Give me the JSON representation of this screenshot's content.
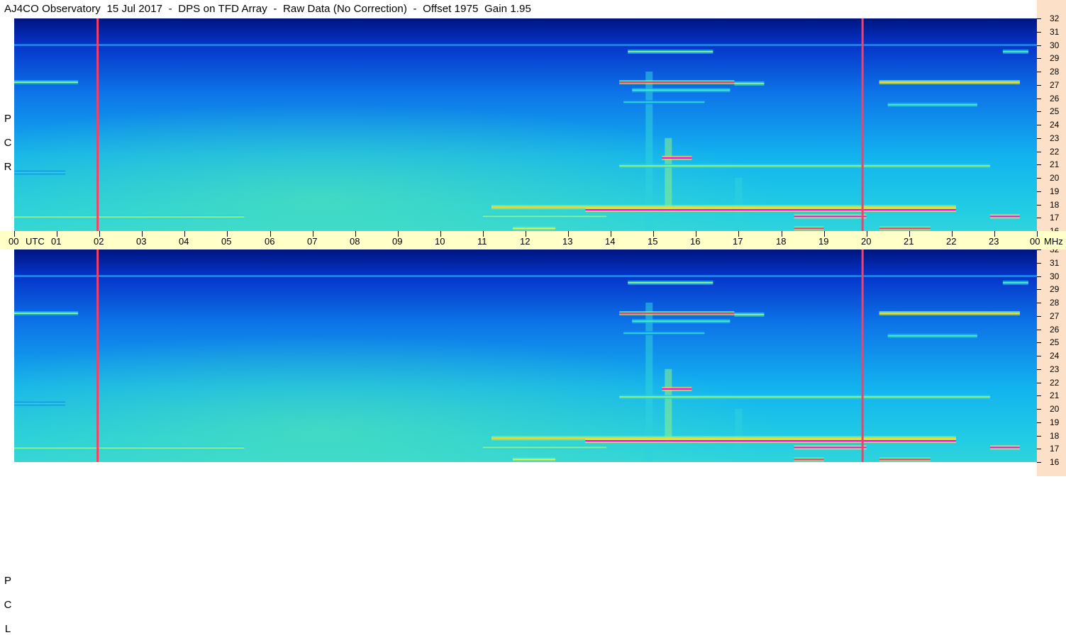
{
  "header": {
    "title": "AJ4CO Observatory  15 Jul 2017  -  DPS on TFD Array  -  Raw Data (No Correction)  -  Offset 1975  Gain 1.95"
  },
  "panels": [
    {
      "id": "rcp",
      "label_letters": [
        "P",
        "C",
        "R"
      ]
    },
    {
      "id": "lcp",
      "label_letters": [
        "P",
        "C",
        "L"
      ]
    }
  ],
  "axes": {
    "frequency_ticks": [
      "32",
      "31",
      "30",
      "29",
      "28",
      "27",
      "26",
      "25",
      "24",
      "23",
      "22",
      "21",
      "20",
      "19",
      "18",
      "17",
      "16"
    ],
    "time_ticks": [
      "00",
      "01",
      "02",
      "03",
      "04",
      "05",
      "06",
      "07",
      "08",
      "09",
      "10",
      "11",
      "12",
      "13",
      "14",
      "15",
      "16",
      "17",
      "18",
      "19",
      "20",
      "21",
      "22",
      "23",
      "00"
    ],
    "time_unit": "UTC",
    "freq_unit": "MHz"
  },
  "colors": {
    "colormap": [
      "#000a8c",
      "#0530c8",
      "#0a5ae6",
      "#0f8cf0",
      "#14bef0",
      "#2ed2dc",
      "#50e6be",
      "#8cf08c",
      "#dcf050",
      "#ffd228",
      "#ff3c64",
      "#ff00ff",
      "#ffffff"
    ],
    "time_axis_bg": "#ffffc8",
    "freq_axis_bg": "#fde0c8",
    "marker_line": "#ff3c64"
  },
  "chart_data": {
    "type": "heatmap",
    "title": "AJ4CO Observatory  15 Jul 2017  -  DPS on TFD Array  -  Raw Data (No Correction)  -  Offset 1975  Gain 1.95",
    "xlabel": "UTC",
    "ylabel": "MHz",
    "xlim": [
      0,
      24
    ],
    "ylim": [
      16,
      32
    ],
    "panels": [
      "RCP",
      "LCP"
    ],
    "marker_lines_utc": [
      1.95,
      19.9
    ],
    "horizontal_line_mhz": [
      30.0
    ],
    "bands": [
      {
        "mhz": 27.2,
        "start_utc": 14.2,
        "end_utc": 16.9,
        "level": 0.82
      },
      {
        "mhz": 27.2,
        "start_utc": 20.3,
        "end_utc": 23.6,
        "level": 0.75
      },
      {
        "mhz": 27.2,
        "start_utc": 0.0,
        "end_utc": 1.5,
        "level": 0.55
      },
      {
        "mhz": 27.1,
        "start_utc": 16.9,
        "end_utc": 17.6,
        "level": 0.6
      },
      {
        "mhz": 29.5,
        "start_utc": 14.4,
        "end_utc": 16.4,
        "level": 0.55
      },
      {
        "mhz": 29.5,
        "start_utc": 23.2,
        "end_utc": 23.8,
        "level": 0.5
      },
      {
        "mhz": 26.6,
        "start_utc": 14.5,
        "end_utc": 16.8,
        "level": 0.5
      },
      {
        "mhz": 25.5,
        "start_utc": 20.5,
        "end_utc": 22.6,
        "level": 0.52
      },
      {
        "mhz": 25.7,
        "start_utc": 14.3,
        "end_utc": 16.2,
        "level": 0.45
      },
      {
        "mhz": 21.5,
        "start_utc": 15.2,
        "end_utc": 15.9,
        "level": 0.95
      },
      {
        "mhz": 20.9,
        "start_utc": 14.2,
        "end_utc": 22.9,
        "level": 0.6
      },
      {
        "mhz": 20.4,
        "start_utc": 0.0,
        "end_utc": 1.2,
        "level": 0.45
      },
      {
        "mhz": 17.8,
        "start_utc": 11.2,
        "end_utc": 22.1,
        "level": 0.75
      },
      {
        "mhz": 17.6,
        "start_utc": 13.4,
        "end_utc": 22.1,
        "level": 0.88
      },
      {
        "mhz": 17.05,
        "start_utc": 0.0,
        "end_utc": 5.4,
        "level": 0.62
      },
      {
        "mhz": 17.1,
        "start_utc": 11.0,
        "end_utc": 13.9,
        "level": 0.58
      },
      {
        "mhz": 17.1,
        "start_utc": 18.3,
        "end_utc": 20.0,
        "level": 0.9
      },
      {
        "mhz": 17.1,
        "start_utc": 22.9,
        "end_utc": 23.6,
        "level": 0.88
      },
      {
        "mhz": 16.2,
        "start_utc": 11.7,
        "end_utc": 12.7,
        "level": 0.7
      },
      {
        "mhz": 16.2,
        "start_utc": 18.3,
        "end_utc": 19.0,
        "level": 0.8
      },
      {
        "mhz": 16.2,
        "start_utc": 20.3,
        "end_utc": 21.5,
        "level": 0.82
      }
    ],
    "vertical_bursts": [
      {
        "utc": 15.35,
        "mhz_range": [
          17.5,
          23.0
        ],
        "level": 0.62
      },
      {
        "utc": 14.9,
        "mhz_range": [
          16.0,
          28.0
        ],
        "level": 0.4
      },
      {
        "utc": 17.0,
        "mhz_range": [
          16.0,
          20.0
        ],
        "level": 0.45
      }
    ]
  }
}
